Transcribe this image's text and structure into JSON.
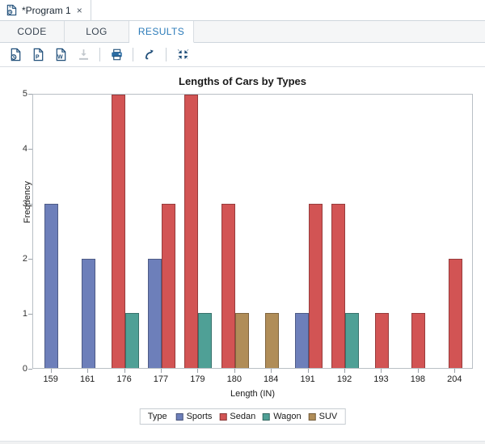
{
  "window": {
    "program_tab": {
      "title": "*Program 1",
      "icon": "sas-program-icon",
      "close": "×"
    }
  },
  "subtabs": [
    {
      "label": "CODE",
      "active": false
    },
    {
      "label": "LOG",
      "active": false
    },
    {
      "label": "RESULTS",
      "active": true
    }
  ],
  "toolbar": {
    "buttons": [
      {
        "name": "open-html-icon",
        "title": "HTML"
      },
      {
        "name": "open-pdf-icon",
        "title": "PDF"
      },
      {
        "name": "open-word-icon",
        "title": "Word"
      },
      {
        "name": "download-icon",
        "title": "Download"
      },
      {
        "name": "print-icon",
        "title": "Print"
      },
      {
        "name": "open-in-new-window-icon",
        "title": "Open in new window"
      },
      {
        "name": "collapse-icon",
        "title": "Maximize view"
      }
    ]
  },
  "colors": {
    "sports": "#6d7fba",
    "sedan": "#d25454",
    "wagon": "#4fa096",
    "suv": "#b08d58",
    "axis": "#b9bfc5",
    "accent": "#2b7bb9"
  },
  "chart_data": {
    "type": "bar",
    "title": "Lengths of Cars by Types",
    "xlabel": "Length (IN)",
    "ylabel": "Frequency",
    "categories": [
      "159",
      "161",
      "176",
      "177",
      "179",
      "180",
      "184",
      "191",
      "192",
      "193",
      "198",
      "204"
    ],
    "yticks": [
      "0",
      "1",
      "2",
      "3",
      "4",
      "5"
    ],
    "ylim": [
      0,
      5
    ],
    "grid": false,
    "legend_position": "bottom",
    "legend_title": "Type",
    "series": [
      {
        "name": "Sports",
        "color": "#6d7fba",
        "values": [
          3,
          2,
          0,
          2,
          0,
          0,
          0,
          1,
          0,
          0,
          0,
          0
        ]
      },
      {
        "name": "Sedan",
        "color": "#d25454",
        "values": [
          0,
          0,
          5,
          3,
          5,
          3,
          0,
          3,
          3,
          1,
          1,
          2
        ]
      },
      {
        "name": "Wagon",
        "color": "#4fa096",
        "values": [
          0,
          0,
          1,
          0,
          1,
          0,
          0,
          0,
          1,
          0,
          0,
          0
        ]
      },
      {
        "name": "SUV",
        "color": "#b08d58",
        "values": [
          0,
          0,
          0,
          0,
          0,
          1,
          1,
          0,
          0,
          0,
          0,
          0
        ]
      }
    ]
  }
}
